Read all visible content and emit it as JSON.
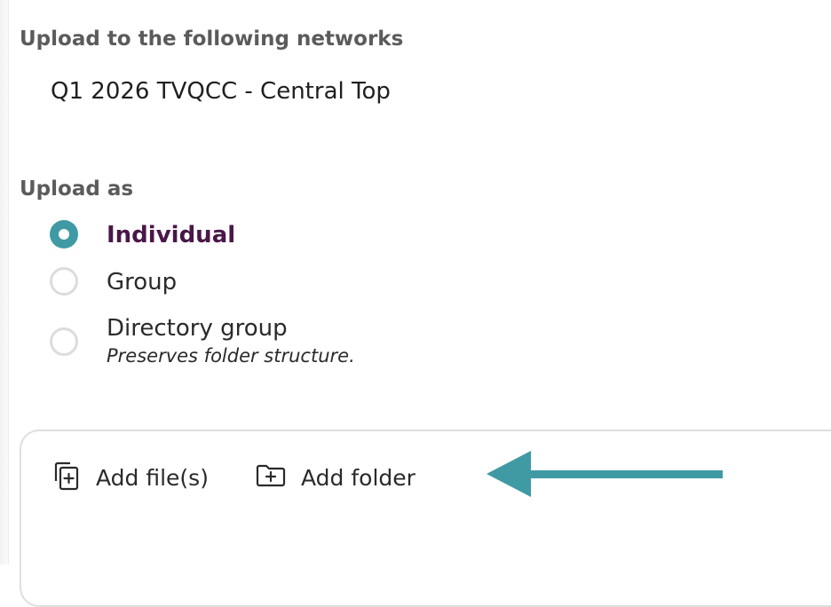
{
  "networks": {
    "heading": "Upload to the following networks",
    "name": "Q1 2026 TVQCC - Central Top"
  },
  "upload_as": {
    "heading": "Upload as",
    "options": [
      {
        "label": "Individual",
        "checked": true
      },
      {
        "label": "Group",
        "checked": false
      },
      {
        "label": "Directory group",
        "hint": "Preserves folder structure.",
        "checked": false
      }
    ]
  },
  "actions": {
    "add_files": {
      "label": "Add file(s)",
      "icon": "add-file-icon"
    },
    "add_folder": {
      "label": "Add folder",
      "icon": "add-folder-icon"
    }
  },
  "annotation": {
    "icon": "left-arrow-icon",
    "color": "#3f9aa3"
  },
  "colors": {
    "accent": "#3f9aa3",
    "selected_text": "#4a1748",
    "section_label": "#5b5b5b"
  }
}
